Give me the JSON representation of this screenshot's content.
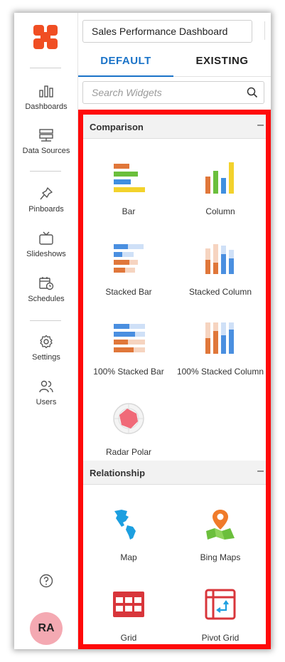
{
  "nav": {
    "items": [
      {
        "label": "Dashboards",
        "icon": "bar-chart-icon"
      },
      {
        "label": "Data Sources",
        "icon": "server-icon"
      },
      {
        "label": "Pinboards",
        "icon": "pin-icon"
      },
      {
        "label": "Slideshows",
        "icon": "tv-icon"
      },
      {
        "label": "Schedules",
        "icon": "calendar-clock-icon"
      },
      {
        "label": "Settings",
        "icon": "gear-icon"
      },
      {
        "label": "Users",
        "icon": "users-icon"
      }
    ],
    "help_icon": "question-icon",
    "avatar_initials": "RA"
  },
  "header": {
    "dashboard_title": "Sales Performance Dashboard"
  },
  "tabs": [
    {
      "label": "DEFAULT",
      "active": true
    },
    {
      "label": "EXISTING",
      "active": false
    }
  ],
  "search": {
    "placeholder": "Search Widgets",
    "icon": "search-icon"
  },
  "sections": [
    {
      "label": "Comparison",
      "collapse": "–",
      "widgets": [
        {
          "label": "Bar",
          "icon": "bar-icon"
        },
        {
          "label": "Column",
          "icon": "column-icon"
        },
        {
          "label": "Stacked Bar",
          "icon": "stacked-bar-icon"
        },
        {
          "label": "Stacked Column",
          "icon": "stacked-column-icon"
        },
        {
          "label": "100% Stacked Bar",
          "icon": "full-stacked-bar-icon"
        },
        {
          "label": "100% Stacked Column",
          "icon": "full-stacked-column-icon"
        },
        {
          "label": "Radar Polar",
          "icon": "radar-polar-icon"
        }
      ]
    },
    {
      "label": "Relationship",
      "collapse": "–",
      "widgets": [
        {
          "label": "Map",
          "icon": "map-icon"
        },
        {
          "label": "Bing Maps",
          "icon": "bing-maps-icon"
        },
        {
          "label": "Grid",
          "icon": "grid-icon"
        },
        {
          "label": "Pivot Grid",
          "icon": "pivot-grid-icon"
        }
      ]
    }
  ],
  "colors": {
    "accent": "#1a73c8",
    "highlight": "#ff0a0a",
    "brand": "#f04e23",
    "avatar": "#f4a9b2"
  }
}
